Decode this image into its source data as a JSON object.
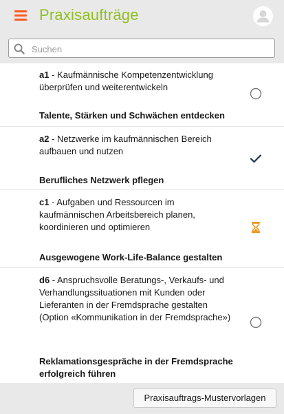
{
  "header": {
    "title": "Praxisaufträge",
    "menu_icon": "hamburger-menu-icon",
    "avatar_icon": "user-avatar-icon",
    "accent_color": "#ff5a1f",
    "title_color": "#8fbf1f"
  },
  "search": {
    "placeholder": "Suchen",
    "value": "",
    "icon": "search-icon"
  },
  "items": [
    {
      "code": "a1",
      "description": " - Kaufmännische Kompetenzentwicklung überprüfen und weiterentwickeln",
      "subtitle": "Talente, Stärken und Schwächen entdecken",
      "status": "open",
      "status_icon": "empty-circle-icon"
    },
    {
      "code": "a2",
      "description": " - Netzwerke im kaufmännischen Bereich aufbauen und nutzen",
      "subtitle": "Berufliches Netzwerk pflegen",
      "status": "completed",
      "status_icon": "checkmark-icon"
    },
    {
      "code": "c1",
      "description": " - Aufgaben und Ressourcen im kaufmännischen Arbeitsbereich planen, koordinieren und optimieren",
      "subtitle": "Ausgewogene Work-Life-Balance gestalten",
      "status": "in-progress",
      "status_icon": "hourglass-icon"
    },
    {
      "code": "d6",
      "description": " - Anspruchsvolle Beratungs-, Verkaufs- und Verhandlungssituationen mit Kunden oder Lieferanten in der Fremdsprache gestalten (Option «Kommunikation in der Fremdsprache»)",
      "subtitle": "Reklamationsgespräche in der Fremdsprache erfolgreich führen",
      "status": "open",
      "status_icon": "empty-circle-icon"
    }
  ],
  "footer": {
    "button_label": "Praxisauftrags-Mustervorlagen"
  }
}
